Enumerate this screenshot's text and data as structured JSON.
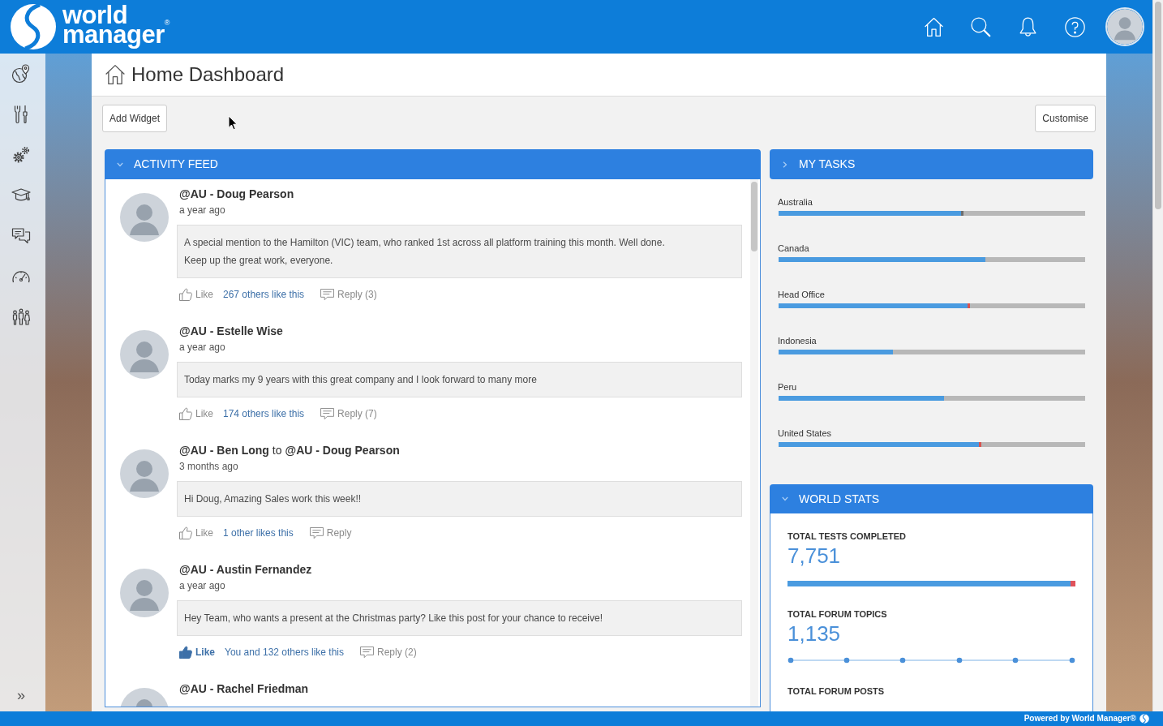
{
  "header": {
    "brand": [
      "world",
      "manager$^{®}$"
    ]
  },
  "sidebar": {
    "toggle": "»"
  },
  "page": {
    "title": "Home Dashboard",
    "add_button": "Add Widget",
    "customise_button": "Customise"
  },
  "activity_feed": {
    "title": "ACTIVITY FEED",
    "expanded": true,
    "posts": [
      {
        "author": "@AU - Doug Pearson",
        "time": "a year ago",
        "message": [
          "A special mention to the Hamilton (VIC) team, who ranked 1st across all platform training this month. Well done.",
          "Keep up the great work, everyone."
        ],
        "like_label": "Like",
        "liked": false,
        "likes": "267 others like this",
        "reply": "Reply (3)"
      },
      {
        "author": "@AU - Estelle Wise",
        "time": "a year ago",
        "message": [
          "Today marks my 9 years with this great company and I look forward to many more"
        ],
        "like_label": "Like",
        "liked": false,
        "likes": "174 others like this",
        "reply": "Reply (7)"
      },
      {
        "author": "@AU - Ben Long",
        "connector": "to",
        "recipient": "@AU - Doug Pearson",
        "time": "3 months ago",
        "message": [
          "Hi Doug, Amazing Sales work this week!!"
        ],
        "like_label": "Like",
        "liked": false,
        "likes": "1 other likes this",
        "reply": "Reply"
      },
      {
        "author": "@AU - Austin Fernandez",
        "time": "a year ago",
        "message": [
          "Hey Team, who wants a present at the Christmas party? Like this post for your chance to receive!"
        ],
        "like_label": "Like",
        "liked": true,
        "likes": "You and 132 others like this",
        "reply": "Reply (2)"
      },
      {
        "author": "@AU - Rachel Friedman"
      }
    ]
  },
  "my_tasks": {
    "title": "MY TASKS",
    "expanded": false,
    "items": [
      {
        "label": "Australia",
        "level": 0.595,
        "color": "#6e6e6e"
      },
      {
        "label": "Canada",
        "level": 0.675
      },
      {
        "label": "Head Office",
        "level": 0.616,
        "color": "#d9534f"
      },
      {
        "label": "Indonesia",
        "level": 0.373
      },
      {
        "label": "Peru",
        "level": 0.54
      },
      {
        "label": "United States",
        "level": 0.653,
        "color": "#d9534f"
      }
    ]
  },
  "world_stats": {
    "title": "WORLD STATS",
    "expanded": true,
    "stats": [
      {
        "kind": "progress",
        "label": "TOTAL TESTS COMPLETED",
        "value": "7,751",
        "level": 0.983
      },
      {
        "kind": "sparkline",
        "label": "TOTAL FORUM TOPICS",
        "value": "1,135"
      },
      {
        "kind": "plain",
        "label": "TOTAL FORUM POSTS"
      }
    ]
  },
  "footer": {
    "text": "Powered by World Manager®"
  }
}
